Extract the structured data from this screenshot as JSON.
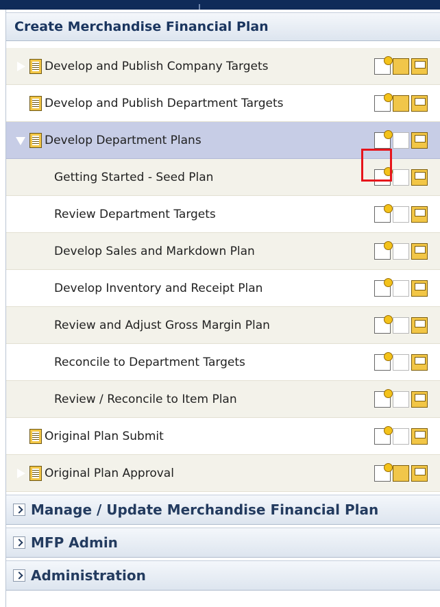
{
  "topbar": {
    "color": "#0f2b59"
  },
  "panel": {
    "title": "Create Merchandise Financial Plan",
    "items": [
      {
        "label": "Develop and Publish Company Targets",
        "expander": "right",
        "type": "parent"
      },
      {
        "label": "Develop and Publish Department Targets",
        "expander": "right",
        "type": "parent"
      },
      {
        "label": "Develop Department Plans",
        "expander": "down",
        "type": "parent",
        "selected": true
      },
      {
        "label": "Getting Started - Seed Plan",
        "type": "child"
      },
      {
        "label": "Review Department Targets",
        "type": "child"
      },
      {
        "label": "Develop Sales and Markdown Plan",
        "type": "child"
      },
      {
        "label": "Develop Inventory and Receipt Plan",
        "type": "child"
      },
      {
        "label": "Review and Adjust Gross Margin Plan",
        "type": "child"
      },
      {
        "label": "Reconcile to Department Targets",
        "type": "child"
      },
      {
        "label": "Review / Reconcile to Item Plan",
        "type": "child"
      },
      {
        "label": "Original Plan Submit",
        "expander": "right",
        "type": "parent"
      },
      {
        "label": "Original Plan Approval",
        "expander": "right",
        "type": "parent"
      }
    ]
  },
  "sections": [
    {
      "title": "Manage / Update Merchandise Financial Plan"
    },
    {
      "title": "MFP Admin"
    },
    {
      "title": "Administration"
    }
  ],
  "icons": {
    "new": "new-workbook-icon",
    "open": "open-workbook-icon",
    "folder": "folder-icon",
    "book": "activity-book-icon"
  },
  "colors": {
    "selected_row": "#c7cde6",
    "highlight": "#e6141b"
  }
}
